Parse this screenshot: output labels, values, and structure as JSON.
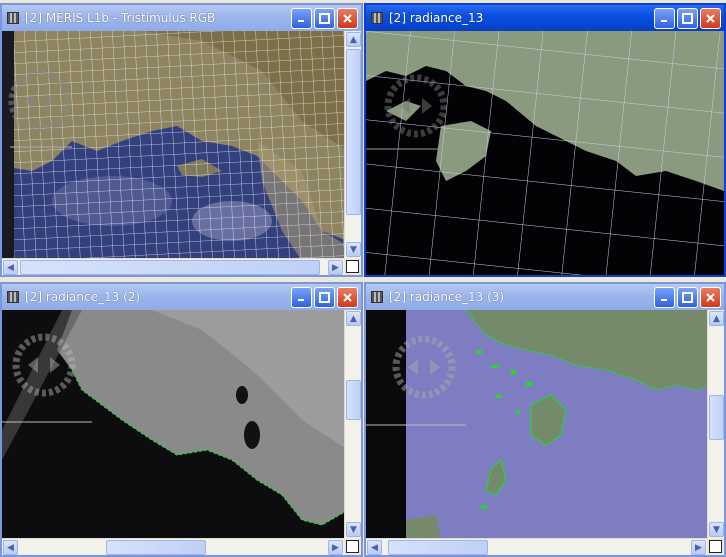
{
  "windows": [
    {
      "id": "w1",
      "title": "[2] MERIS L1b - Tristimulus RGB",
      "active": false
    },
    {
      "id": "w2",
      "title": "[2] radiance_13",
      "active": true
    },
    {
      "id": "w3",
      "title": "[2] radiance_13 (2)",
      "active": false
    },
    {
      "id": "w4",
      "title": "[2] radiance_13 (3)",
      "active": false
    }
  ],
  "colors": {
    "title_active": "#0a4fe0",
    "title_inactive": "#9cb6ec",
    "land_rgb": "#8e8460",
    "sea_rgb": "#34407d",
    "land_gray": "#7f8c72",
    "sea_overlay": "#7f7dc2",
    "coast_green": "#24d43a"
  },
  "icons": [
    "window-icon",
    "minimize-icon",
    "maximize-icon",
    "close-icon",
    "navigation-overlay-icon",
    "scroll-up-icon",
    "scroll-down-icon",
    "scroll-left-icon",
    "scroll-right-icon",
    "pan-corner-icon"
  ]
}
